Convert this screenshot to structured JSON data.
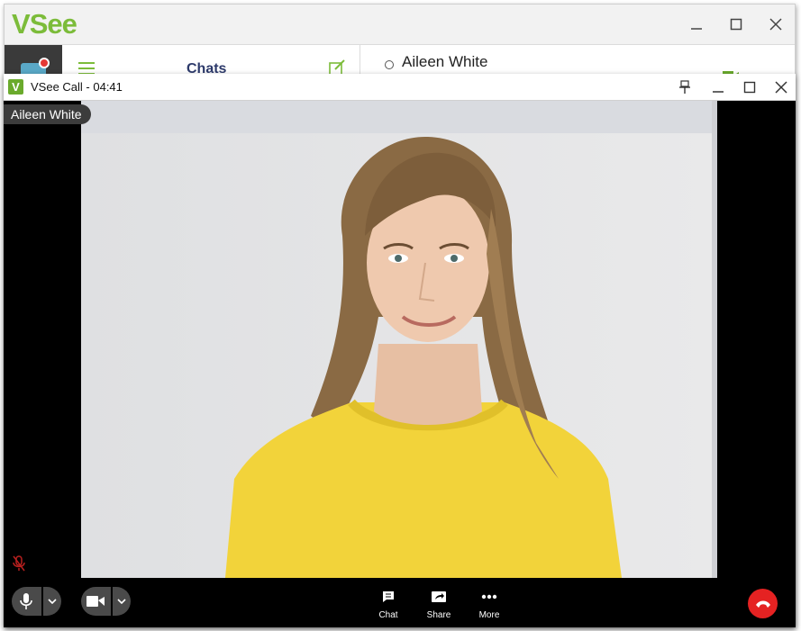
{
  "app": {
    "logo_v": "V",
    "logo_see": "See",
    "chats_title": "Chats",
    "contact_name": "Aileen White"
  },
  "call": {
    "window_title": "VSee Call - 04:41",
    "participant_name": "Aileen White"
  },
  "controls": {
    "chat_label": "Chat",
    "share_label": "Share",
    "more_label": "More"
  },
  "colors": {
    "brand_green": "#7cbc3a",
    "hangup_red": "#e52222",
    "chats_title": "#2d3a6b"
  },
  "icons": {
    "mic": "microphone-icon",
    "camera": "video-camera-icon",
    "chat": "chat-bubble-icon",
    "share": "share-screen-icon",
    "more": "ellipsis-icon",
    "hangup": "phone-hangup-icon"
  }
}
